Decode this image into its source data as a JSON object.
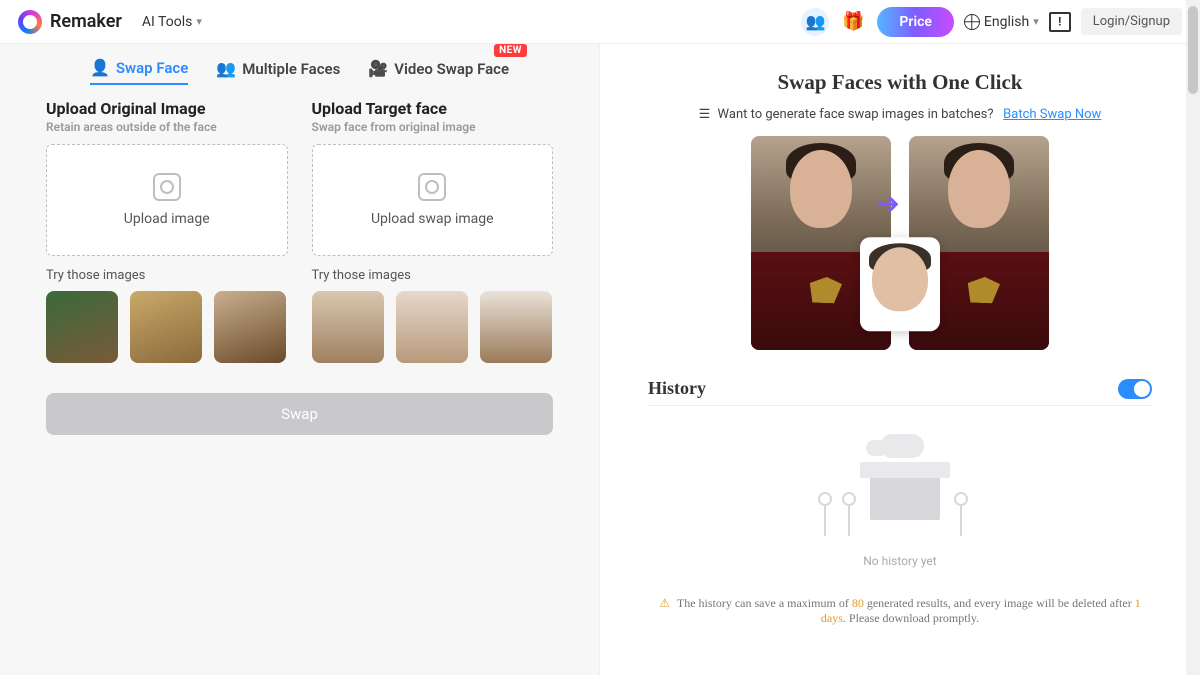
{
  "header": {
    "brand": "Remaker",
    "aitools": "AI Tools",
    "price": "Price",
    "language": "English",
    "login": "Login/Signup"
  },
  "tabs": {
    "swap": "Swap Face",
    "multi": "Multiple Faces",
    "video": "Video Swap Face",
    "new_badge": "NEW"
  },
  "upload_original": {
    "title": "Upload Original Image",
    "subtitle": "Retain areas outside of the face",
    "drop_label": "Upload image",
    "try_label": "Try those images"
  },
  "upload_target": {
    "title": "Upload Target face",
    "subtitle": "Swap face from original image",
    "drop_label": "Upload swap image",
    "try_label": "Try those images"
  },
  "swap_button": "Swap",
  "right": {
    "title": "Swap Faces with One Click",
    "batch_prompt": "Want to generate face swap images in batches?",
    "batch_link": "Batch Swap Now",
    "history": "History",
    "no_history": "No history yet",
    "note_pre": "The history can save a maximum of ",
    "note_max": "80",
    "note_mid": " generated results, and every image will be deleted after ",
    "note_days": "1 days",
    "note_post": ". Please download promptly."
  },
  "thumb_colors": {
    "orig": [
      "#7a5a3a",
      "#b88a4a",
      "#8a6a3a"
    ],
    "targ": [
      "#d9c7b0",
      "#e6d8cc",
      "#eae2d8"
    ]
  }
}
